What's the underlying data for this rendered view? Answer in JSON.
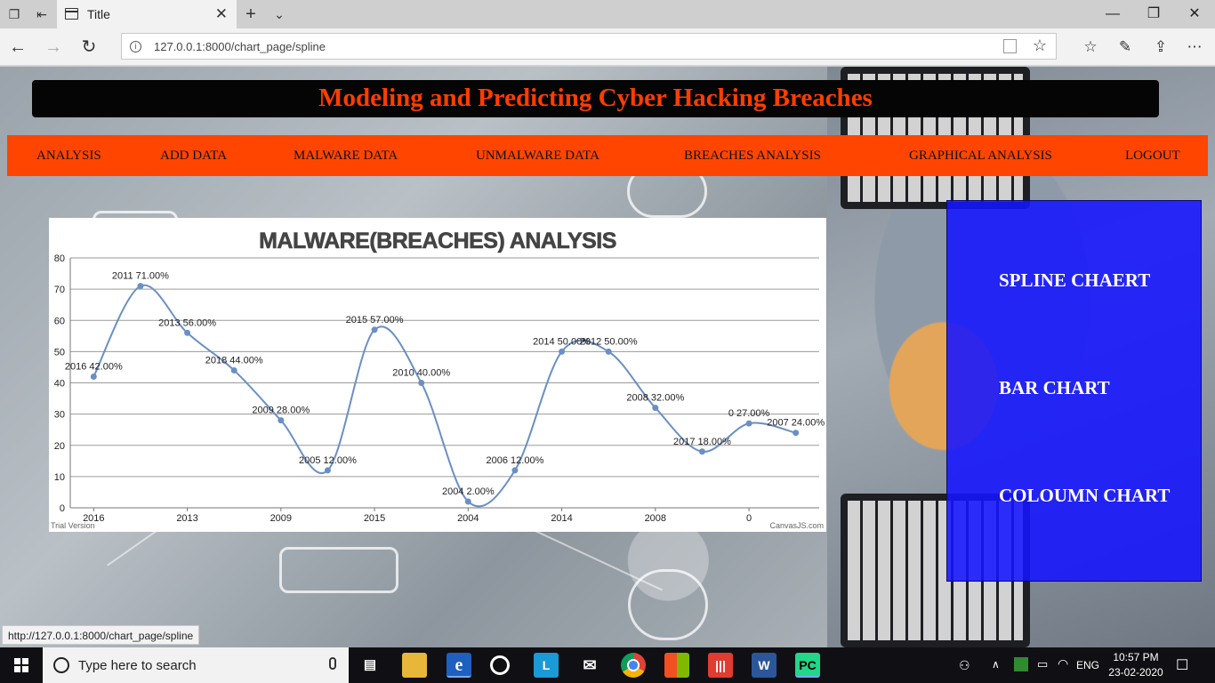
{
  "browser": {
    "tab_title": "Title",
    "url": "127.0.0.1:8000/chart_page/spline",
    "status_url": "http://127.0.0.1:8000/chart_page/spline"
  },
  "site": {
    "title": "Modeling and Predicting Cyber Hacking Breaches",
    "menu": [
      "ANALYSIS",
      "ADD DATA",
      "MALWARE DATA",
      "UNMALWARE DATA",
      "BREACHES ANALYSIS",
      "GRAPHICAL ANALYSIS",
      "LOGOUT"
    ]
  },
  "side_panel": {
    "links": [
      "SPLINE CHAERT",
      "BAR CHART",
      "COLOUMN CHART"
    ]
  },
  "chart_data": {
    "type": "line",
    "title": "MALWARE(BREACHES) ANALYSIS",
    "categories": [
      "2016",
      "2011",
      "2013",
      "2018",
      "2009",
      "2005",
      "2015",
      "2010",
      "2004",
      "2006",
      "2014",
      "2012",
      "2008",
      "2017",
      "0",
      "2007"
    ],
    "values": [
      42,
      71,
      56,
      44,
      28,
      12,
      57,
      40,
      2,
      12,
      50,
      50,
      32,
      18,
      27,
      24
    ],
    "data_labels": [
      "2016 42.00%",
      "2011 71.00%",
      "2013 56.00%",
      "2018 44.00%",
      "2009 28.00%",
      "2005 12.00%",
      "2015 57.00%",
      "2010 40.00%",
      "2004 2.00%",
      "2006 12.00%",
      "2014 50.00%",
      "2012 50.00%",
      "2008 32.00%",
      "2017 18.00%",
      "0 27.00%",
      "2007 24.00%"
    ],
    "x_tick_labels": [
      "2016",
      "2013",
      "2009",
      "2015",
      "2004",
      "2014",
      "2008",
      "0"
    ],
    "y_ticks": [
      0,
      10,
      20,
      30,
      40,
      50,
      60,
      70,
      80
    ],
    "ylim": [
      0,
      80
    ],
    "grid": true,
    "line_color": "#6a8fc4",
    "footer_left": "Trial Version",
    "footer_right": "CanvasJS.com"
  },
  "taskbar": {
    "search_placeholder": "Type here to search",
    "language": "ENG",
    "time": "10:57 PM",
    "date": "23-02-2020"
  },
  "colors": {
    "title_text": "#ff3d00",
    "menu_bg": "#ff4500",
    "panel_bg": "#1414ff"
  }
}
